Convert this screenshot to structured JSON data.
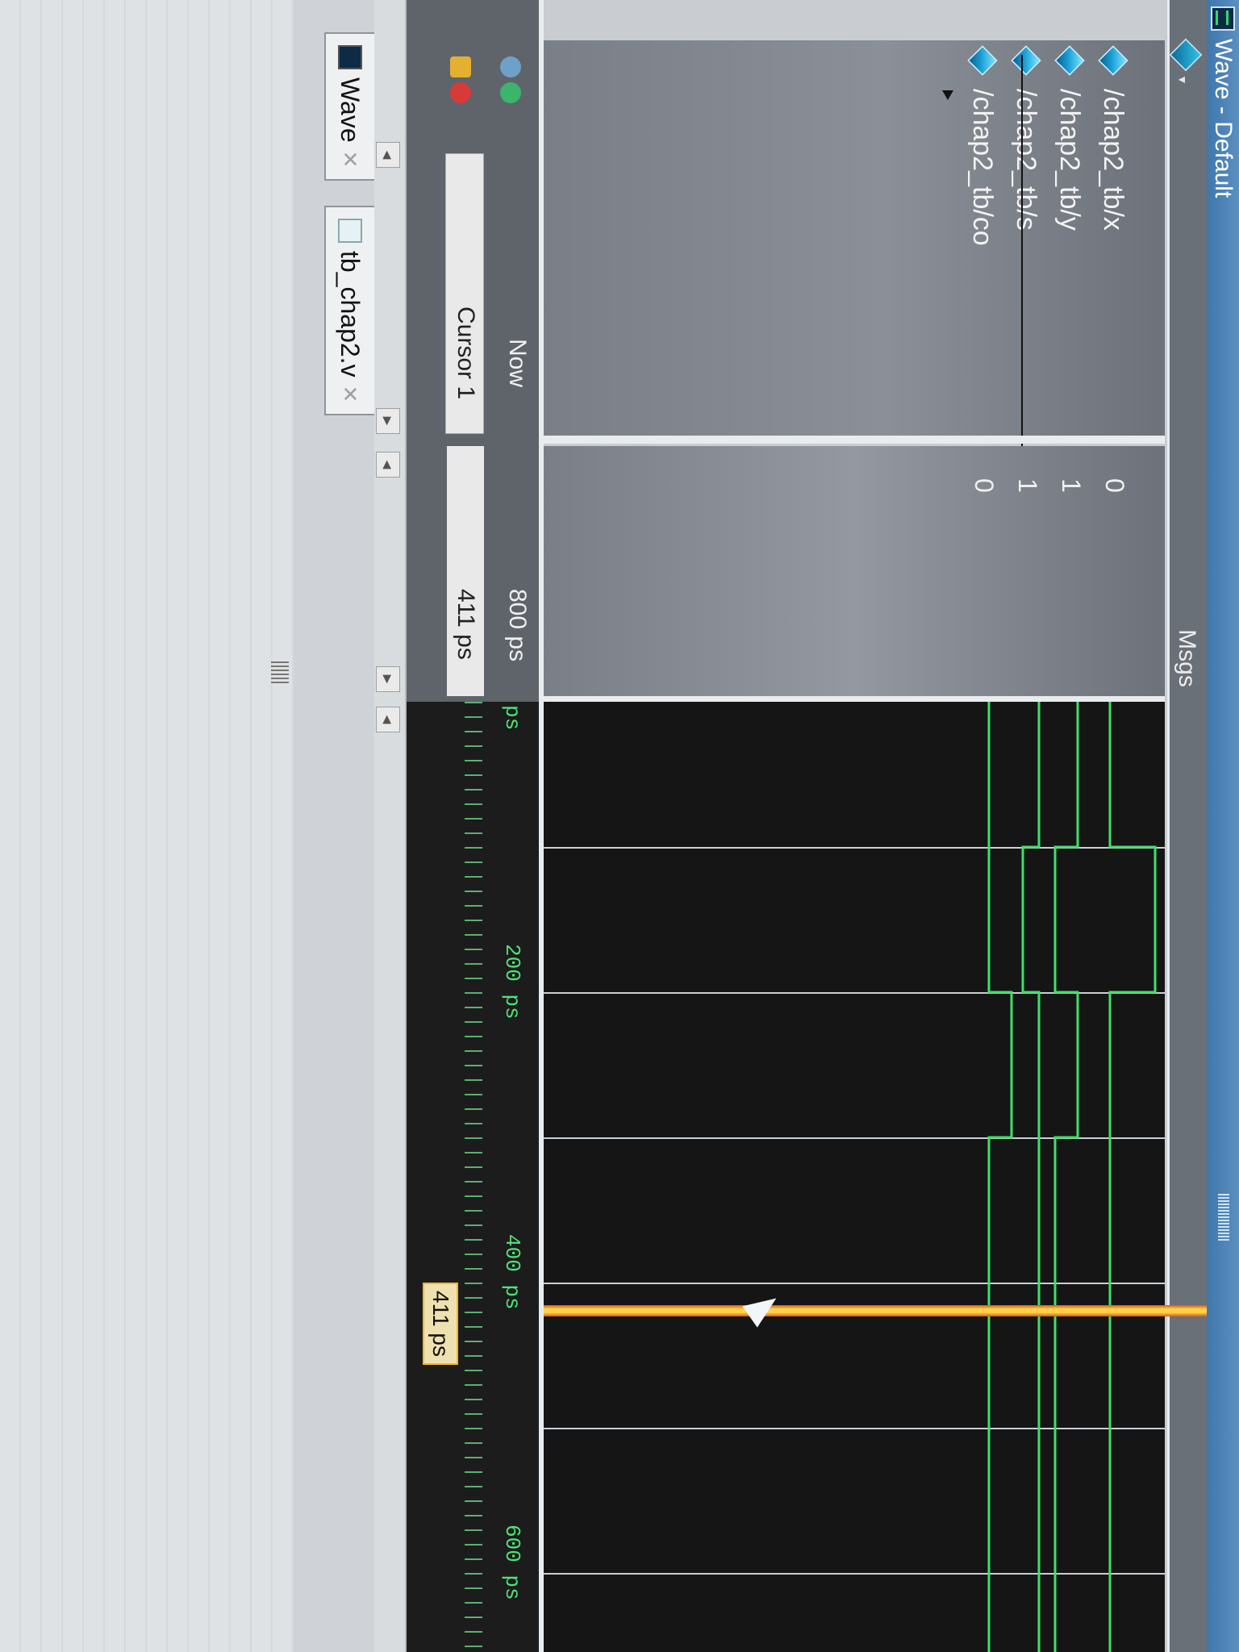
{
  "window": {
    "title": "Wave - Default"
  },
  "panes": {
    "messages_label": "Msgs"
  },
  "signals": [
    {
      "name": "/chap2_tb/x",
      "value": "0"
    },
    {
      "name": "/chap2_tb/y",
      "value": "1"
    },
    {
      "name": "/chap2_tb/s",
      "value": "1"
    },
    {
      "name": "/chap2_tb/co",
      "value": "0"
    }
  ],
  "footer": {
    "now_label": "Now",
    "now_value": "800 ps",
    "cursor_label": "Cursor 1",
    "cursor_value": "411 ps"
  },
  "timeline": {
    "labels": [
      "ps",
      "200 ps",
      "400 ps",
      "600 ps"
    ],
    "cursor_badge": "411 ps"
  },
  "tabs": [
    {
      "label": "Wave"
    },
    {
      "label": "tb_chap2.v"
    }
  ],
  "colors": {
    "wave_background": "#151515",
    "wave_trace": "#3ee06a",
    "cursor": "#ffd34a",
    "title_bar": "#4a80b5"
  }
}
